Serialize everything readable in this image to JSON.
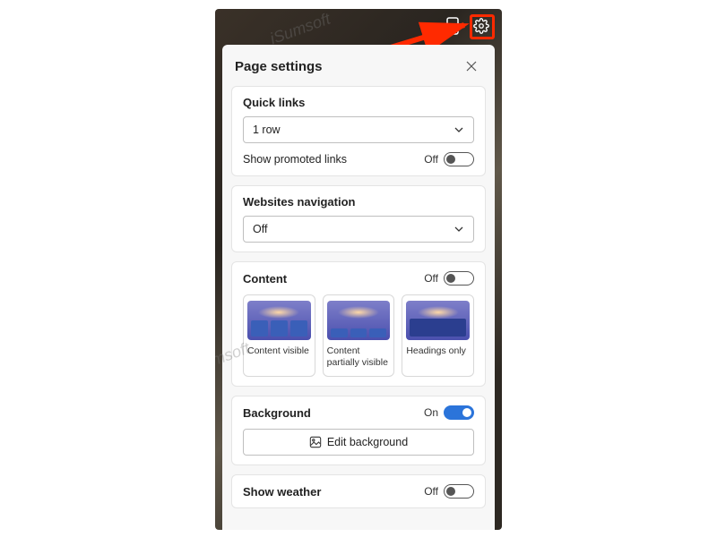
{
  "panel": {
    "title": "Page settings",
    "quicklinks": {
      "title": "Quick links",
      "select_value": "1 row",
      "promoted_label": "Show promoted links",
      "promoted_state": "Off"
    },
    "websites": {
      "title": "Websites navigation",
      "select_value": "Off"
    },
    "content": {
      "title": "Content",
      "state": "Off",
      "opts": {
        "a": "Content visible",
        "b": "Content partially visible",
        "c": "Headings only"
      }
    },
    "background": {
      "title": "Background",
      "state": "On",
      "edit_label": "Edit background"
    },
    "weather": {
      "title": "Show weather",
      "state": "Off"
    }
  },
  "watermark": "iSumsoft"
}
